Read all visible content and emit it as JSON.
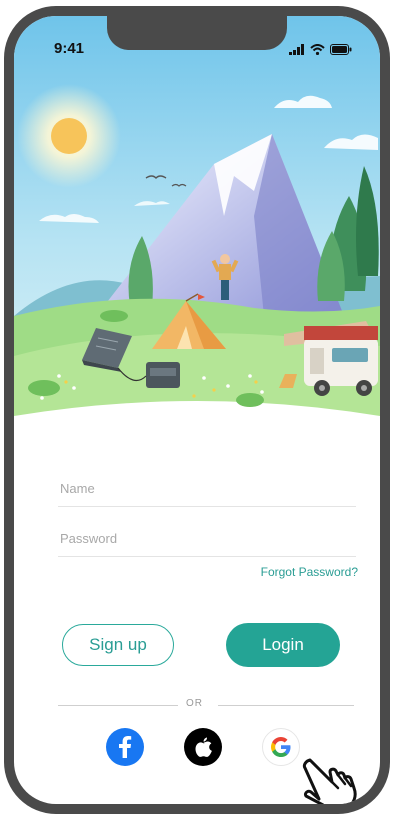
{
  "status_bar": {
    "time": "9:41"
  },
  "form": {
    "name_placeholder": "Name",
    "password_placeholder": "Password",
    "forgot_password": "Forgot Password?",
    "signup_label": "Sign up",
    "login_label": "Login",
    "divider_text": "OR"
  },
  "social": [
    {
      "icon": "facebook-icon",
      "color": "#1877f2"
    },
    {
      "icon": "apple-icon",
      "color": "#000000"
    },
    {
      "icon": "google-icon",
      "color": "#ffffff"
    }
  ],
  "colors": {
    "accent": "#24a495",
    "sky": "#8fd0ee",
    "grass": "#8fd58c"
  }
}
